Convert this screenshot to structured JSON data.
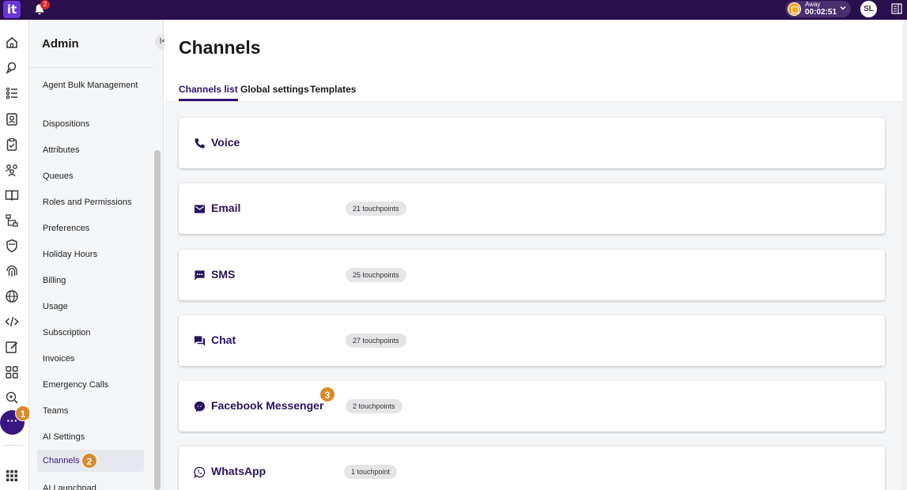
{
  "topbar": {
    "logo": "it",
    "notification_count": "2",
    "status_label": "Away",
    "status_timer": "00:02:51",
    "avatar_initials": "SL"
  },
  "rail": {
    "icons": [
      "home-icon",
      "conversations-icon",
      "list-icon",
      "contacts-icon",
      "clipboard-icon",
      "users-icon",
      "book-icon",
      "flow-icon",
      "shield-icon",
      "fingerprint-icon",
      "globe-icon",
      "code-icon",
      "edit-icon",
      "grid-icon",
      "ai-icon"
    ],
    "more_label": "···",
    "step_marker": "1"
  },
  "sidebar": {
    "title": "Admin",
    "collapse_label": "I<",
    "items": [
      {
        "label": "Agent Bulk Management"
      },
      {
        "label": "Dispositions"
      },
      {
        "label": "Attributes"
      },
      {
        "label": "Queues"
      },
      {
        "label": "Roles and Permissions"
      },
      {
        "label": "Preferences"
      },
      {
        "label": "Holiday Hours"
      },
      {
        "label": "Billing"
      },
      {
        "label": "Usage"
      },
      {
        "label": "Subscription"
      },
      {
        "label": "Invoices"
      },
      {
        "label": "Emergency Calls"
      },
      {
        "label": "Teams"
      },
      {
        "label": "AI Settings"
      },
      {
        "label": "Channels"
      },
      {
        "label": "AI Launchpad"
      }
    ],
    "active_item": "Channels",
    "step_marker": "2"
  },
  "main": {
    "title": "Channels",
    "tabs": [
      {
        "label": "Channels list",
        "active": true
      },
      {
        "label": "Global settings",
        "active": false
      },
      {
        "label": "Templates",
        "active": false
      }
    ],
    "channels": [
      {
        "name": "Voice",
        "icon": "phone-icon",
        "touchpoints": ""
      },
      {
        "name": "Email",
        "icon": "email-icon",
        "touchpoints": "21 touchpoints"
      },
      {
        "name": "SMS",
        "icon": "sms-icon",
        "touchpoints": "25 touchpoints"
      },
      {
        "name": "Chat",
        "icon": "chat-icon",
        "touchpoints": "27 touchpoints"
      },
      {
        "name": "Facebook Messenger",
        "icon": "messenger-icon",
        "touchpoints": "2 touchpoints"
      },
      {
        "name": "WhatsApp",
        "icon": "whatsapp-icon",
        "touchpoints": "1 touchpoint"
      }
    ],
    "step_marker": "3"
  },
  "colors": {
    "topbar": "#2a0f4d",
    "accent": "#2f1470",
    "step_marker": "#d98a2b",
    "status_icon": "#f5a623"
  }
}
